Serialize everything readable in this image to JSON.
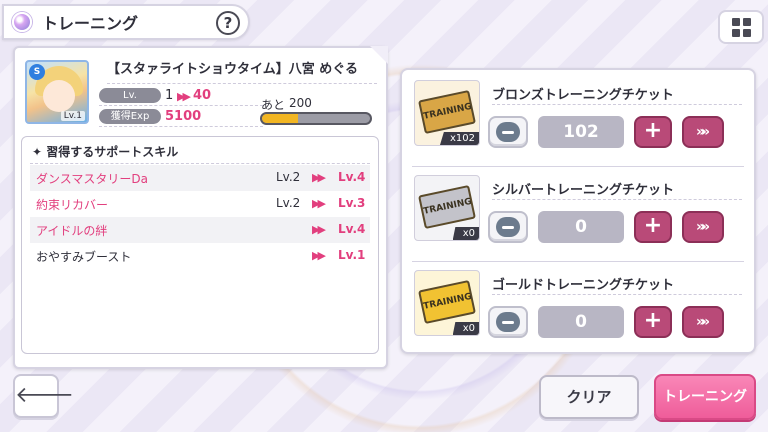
{
  "header": {
    "title": "トレーニング",
    "help_label": "?"
  },
  "character": {
    "name": "【スタァライトショウタイム】八宮 めぐる",
    "rank_badge": "S",
    "portrait_level": "Lv.1",
    "level_label": "Lv.",
    "level_from": "1",
    "level_to": "40",
    "exp_label": "獲得Exp",
    "exp_value": "5100",
    "remain_label": "あと",
    "remain_value": "200",
    "exp_progress": 0.33
  },
  "skills": {
    "title": "✦ 習得するサポートスキル",
    "items": [
      {
        "name": "ダンスマスタリーDa",
        "from": "Lv.2",
        "to": "Lv.4",
        "is_new": true
      },
      {
        "name": "約束リカバー",
        "from": "Lv.2",
        "to": "Lv.3",
        "is_new": true
      },
      {
        "name": "アイドルの絆",
        "from": "",
        "to": "Lv.4",
        "is_new": true
      },
      {
        "name": "おやすみブースト",
        "from": "",
        "to": "Lv.1",
        "is_new": false
      }
    ]
  },
  "tickets": [
    {
      "name": "ブロンズトレーニングチケット",
      "owned": "x102",
      "quantity": "102",
      "ticket_text": "TRAINING",
      "color": "#d9a646"
    },
    {
      "name": "シルバートレーニングチケット",
      "owned": "x0",
      "quantity": "0",
      "ticket_text": "TRAINING",
      "color": "#b8b8bf"
    },
    {
      "name": "ゴールドトレーニングチケット",
      "owned": "x0",
      "quantity": "0",
      "ticket_text": "TRAINING",
      "color": "#f1c232"
    }
  ],
  "buttons": {
    "back_icon": "🡐",
    "clear_label": "クリア",
    "training_label": "トレーニング",
    "plus_label": "+",
    "max_label": "»"
  },
  "colors": {
    "accent_pink": "#ef5d9a",
    "plus_button": "#b94a78",
    "exp_bar_fill": "#f2b623"
  }
}
